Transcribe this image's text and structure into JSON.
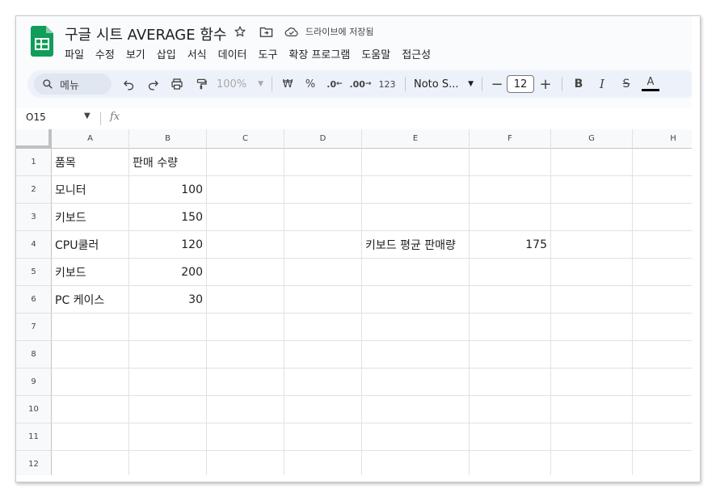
{
  "document": {
    "title": "구글 시트 AVERAGE 함수",
    "saved_status": "드라이브에 저장됨"
  },
  "icons": {
    "star": "star-icon",
    "move": "folder-move-icon",
    "cloud": "cloud-check-icon"
  },
  "menu": [
    "파일",
    "수정",
    "보기",
    "삽입",
    "서식",
    "데이터",
    "도구",
    "확장 프로그램",
    "도움말",
    "접근성"
  ],
  "toolbar": {
    "search_label": "메뉴",
    "zoom": "100%",
    "currency": "₩",
    "percent": "%",
    "dec_decrease": ".0",
    "dec_increase": ".00",
    "number_format": "123",
    "font": "Noto S...",
    "font_size": "12",
    "bold": "B",
    "italic": "I",
    "strike": "S",
    "text_color": "A"
  },
  "formula_bar": {
    "cell_ref": "O15",
    "fx": "fx",
    "content": ""
  },
  "columns": [
    "A",
    "B",
    "C",
    "D",
    "E",
    "F",
    "G",
    "H"
  ],
  "rows": [
    "1",
    "2",
    "3",
    "4",
    "5",
    "6",
    "7",
    "8",
    "9",
    "10",
    "11",
    "12"
  ],
  "cells": {
    "A1": "품목",
    "B1": "판매 수량",
    "A2": "모니터",
    "B2": "100",
    "A3": "키보드",
    "B3": "150",
    "A4": "CPU쿨러",
    "B4": "120",
    "E4": "키보드 평균 판매량",
    "F4": "175",
    "A5": "키보드",
    "B5": "200",
    "A6": "PC 케이스",
    "B6": "30"
  },
  "colors": {
    "brand_green": "#0f9d58",
    "toolbar_bg": "#edf2fa",
    "app_bg": "#f9fbfd"
  }
}
